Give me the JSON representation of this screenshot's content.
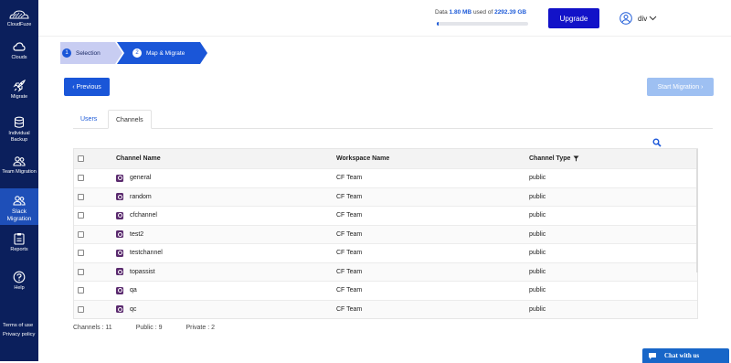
{
  "app": {
    "brand": "CloudFuze"
  },
  "sidebar": {
    "items": [
      {
        "label": "Clouds",
        "icon": "cloud-icon"
      },
      {
        "label": "Migrate",
        "icon": "rocket-icon"
      },
      {
        "label": "Individual Backup",
        "icon": "database-icon"
      },
      {
        "label": "Team Migration",
        "icon": "team-icon"
      },
      {
        "label": "Slack Migration",
        "icon": "team-icon"
      },
      {
        "label": "Reports",
        "icon": "reports-icon"
      },
      {
        "label": "Help",
        "icon": "help-icon"
      }
    ],
    "footer": {
      "terms": "Terms of use",
      "privacy": "Privacy policy"
    },
    "active_index": 4
  },
  "topbar": {
    "data_prefix": "Data",
    "data_used": "1.80 MB",
    "data_mid": "used of",
    "data_total": "2292.39 GB",
    "usage_fraction": 0.01,
    "upgrade_label": "Upgrade",
    "user_name": "div"
  },
  "stepper": {
    "steps": [
      {
        "num": "1",
        "label": "Selection"
      },
      {
        "num": "2",
        "label": "Map & Migrate"
      }
    ],
    "active_index": 1
  },
  "actions": {
    "previous_label": "Previous",
    "start_label": "Start Migration"
  },
  "tabs": [
    {
      "label": "Users"
    },
    {
      "label": "Channels"
    }
  ],
  "table": {
    "columns": {
      "channel_name": "Channel Name",
      "workspace_name": "Workspace Name",
      "channel_type": "Channel Type"
    },
    "rows": [
      {
        "name": "general",
        "workspace": "CF Team",
        "type": "public"
      },
      {
        "name": "random",
        "workspace": "CF Team",
        "type": "public"
      },
      {
        "name": "cfchannel",
        "workspace": "CF Team",
        "type": "public"
      },
      {
        "name": "test2",
        "workspace": "CF Team",
        "type": "public"
      },
      {
        "name": "testchannel",
        "workspace": "CF Team",
        "type": "public"
      },
      {
        "name": "topassist",
        "workspace": "CF Team",
        "type": "public"
      },
      {
        "name": "qa",
        "workspace": "CF Team",
        "type": "public"
      },
      {
        "name": "qc",
        "workspace": "CF Team",
        "type": "public"
      }
    ]
  },
  "summary": {
    "channels": "Channels : 11",
    "public": "Public : 9",
    "private": "Private : 2"
  },
  "chat": {
    "label": "Chat with us"
  },
  "colors": {
    "sidebar_bg": "#0b1f5c",
    "sidebar_active": "#1e4fb8",
    "primary_button": "#1a56d8",
    "upgrade_button": "#1212c8",
    "disabled_button": "#9ec0f2",
    "step_inactive": "#c8cdf2",
    "step_active": "#1a56d8",
    "channel_icon": "#5a2a6e"
  }
}
